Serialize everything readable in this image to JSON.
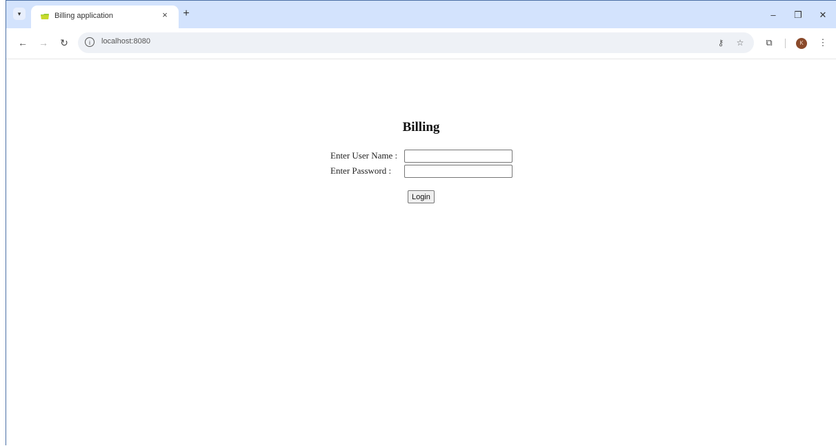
{
  "browser": {
    "tab": {
      "title": "Billing application",
      "close_glyph": "×"
    },
    "new_tab_glyph": "+",
    "tab_search_glyph": "▾",
    "window_controls": {
      "minimize": "–",
      "restore": "❐",
      "close": "✕"
    },
    "nav": {
      "back": "←",
      "forward": "→",
      "reload": "↻"
    },
    "site_info_glyph": "i",
    "url": "localhost:8080",
    "password_key_glyph": "⚷",
    "bookmark_glyph": "☆",
    "extensions_glyph": "⧉",
    "avatar_initial": "K",
    "menu_glyph": "⋮",
    "colors": {
      "tab_strip": "#d3e3fd",
      "favicon": "#9acd32",
      "avatar": "#8a4a2b"
    }
  },
  "page": {
    "title": "Billing",
    "username_label": "Enter User Name :",
    "password_label": "Enter Password :",
    "username_value": "",
    "password_value": "",
    "login_label": "Login"
  }
}
